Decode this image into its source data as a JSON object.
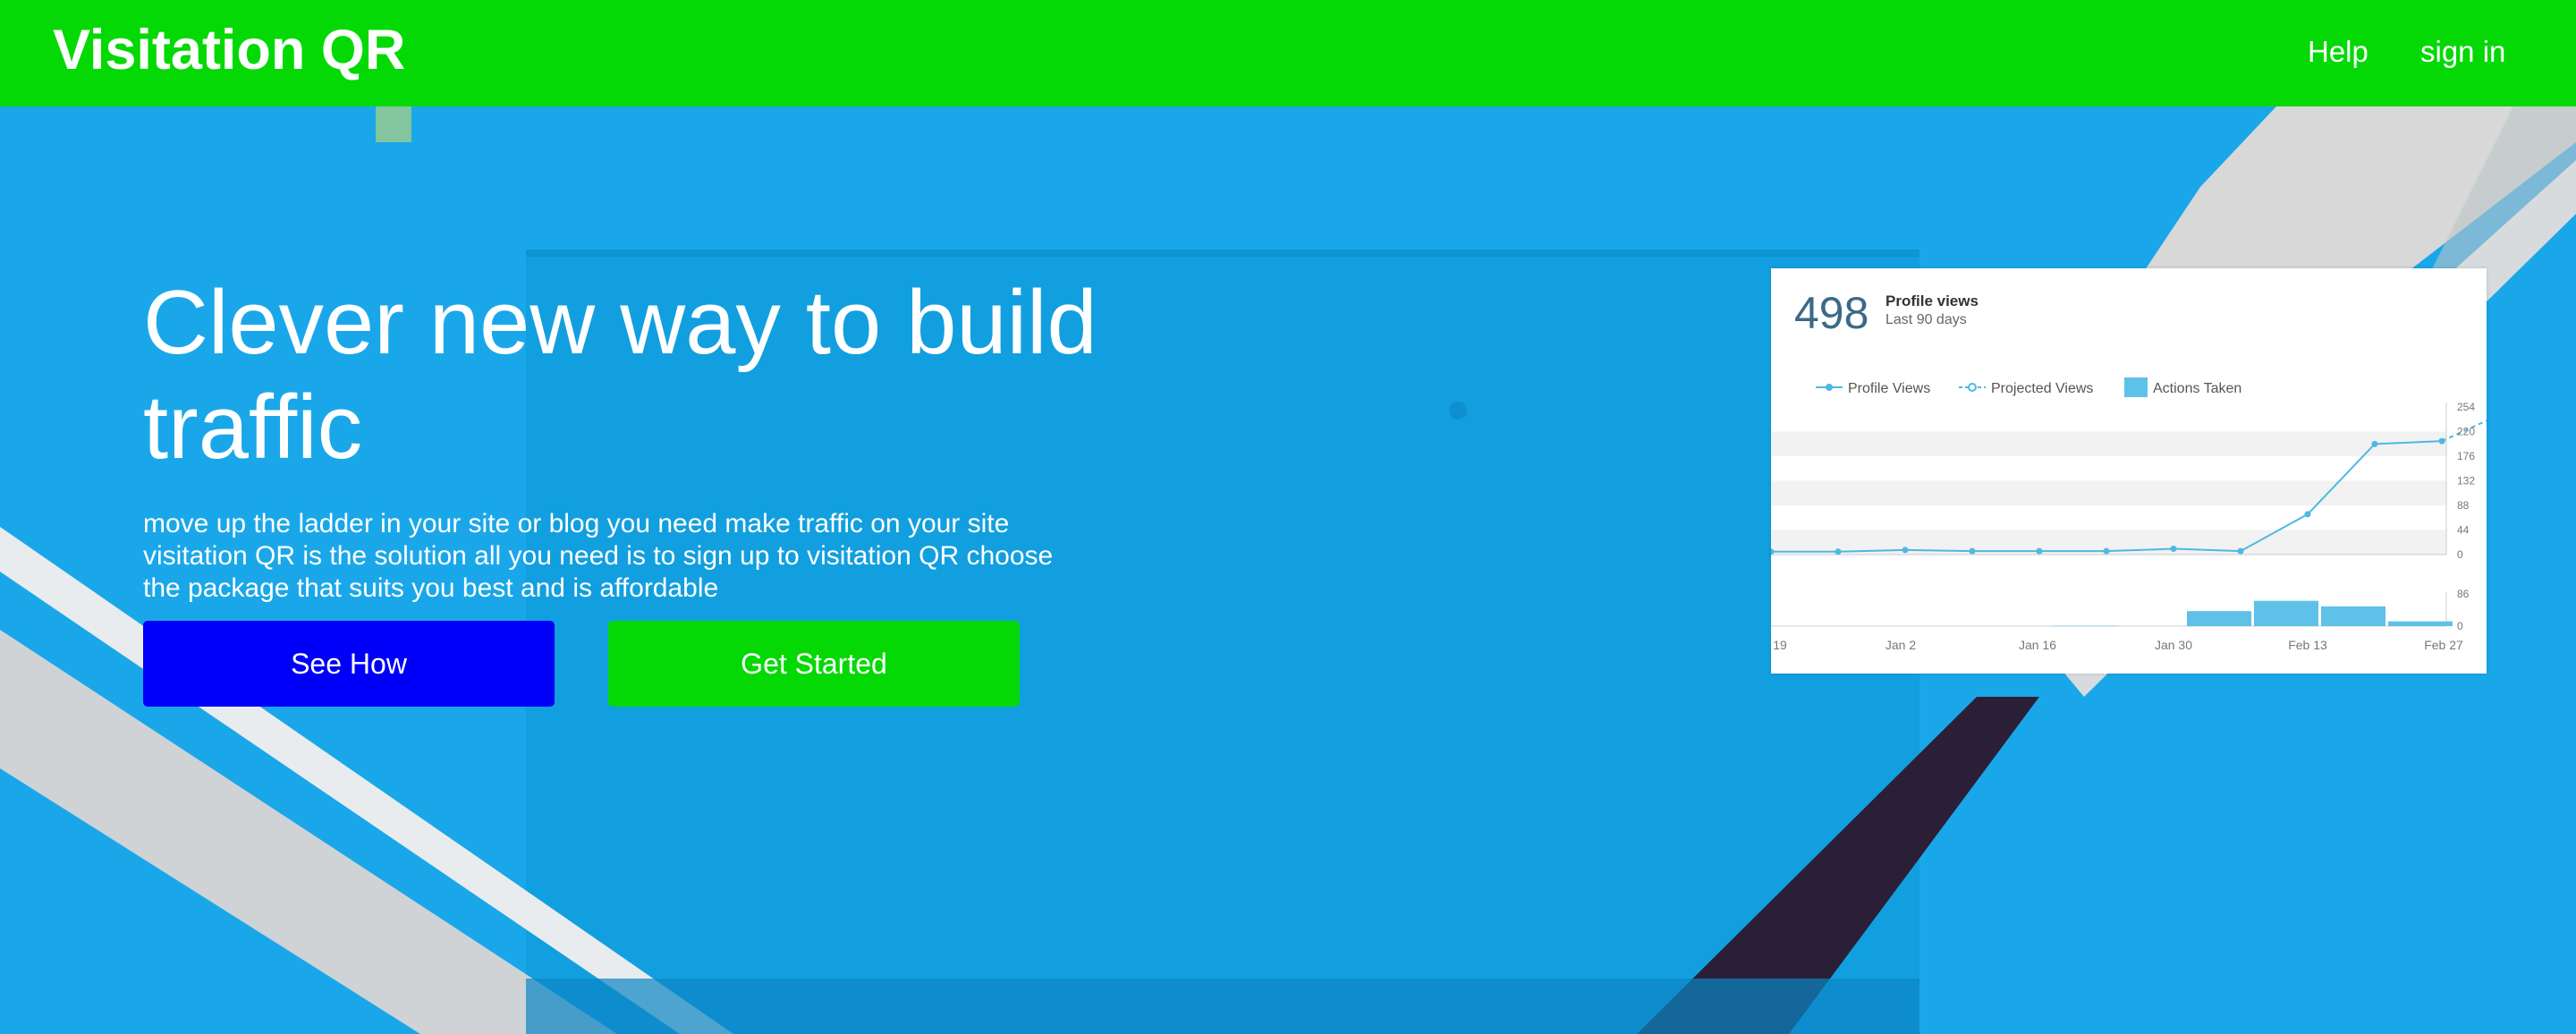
{
  "nav": {
    "brand": "Visitation QR",
    "links": [
      {
        "label": "Help"
      },
      {
        "label": "sign in"
      }
    ]
  },
  "hero": {
    "headline_line1": "Clever new way to build",
    "headline_line2": "traffic",
    "subtext_lines": [
      "move up the ladder in your site or blog you need make traffic on your site",
      "visitation QR is the solution all you need is to sign up to visitation QR choose",
      "the package that suits you best and is affordable"
    ],
    "buttons": {
      "see_how": "See How",
      "get_started": "Get Started"
    }
  },
  "colors": {
    "nav_bg": "#05d905",
    "hero_bg": "#1aa7ea",
    "btn_blue": "#0000fa",
    "btn_green": "#05d905",
    "chart_line": "#4fb8e3",
    "chart_bar": "#5ec1e8"
  },
  "stats_card": {
    "count": "498",
    "label": "Profile views",
    "sublabel": "Last 90 days"
  },
  "chart_data": {
    "type": "line",
    "legend": [
      "Profile Views",
      "Projected Views",
      "Actions Taken"
    ],
    "x_tick_labels": [
      "19",
      "Jan 2",
      "Jan 16",
      "Jan 30",
      "Feb 13",
      "Feb 27"
    ],
    "y_tick_labels": [
      "254",
      "220",
      "176",
      "132",
      "88",
      "44",
      "0"
    ],
    "y2_tick_labels": [
      "86",
      "0"
    ],
    "ylim": [
      0,
      264
    ],
    "series": [
      {
        "name": "Profile Views",
        "values": [
          5,
          5,
          8,
          6,
          6,
          6,
          10,
          6,
          70,
          192,
          197
        ]
      },
      {
        "name": "Projected Views",
        "values": [
          197,
          248
        ]
      }
    ],
    "actions_taken": [
      0,
      0,
      0,
      0,
      1,
      0,
      38,
      64,
      50,
      12
    ],
    "actions_ylim": [
      0,
      86
    ]
  }
}
